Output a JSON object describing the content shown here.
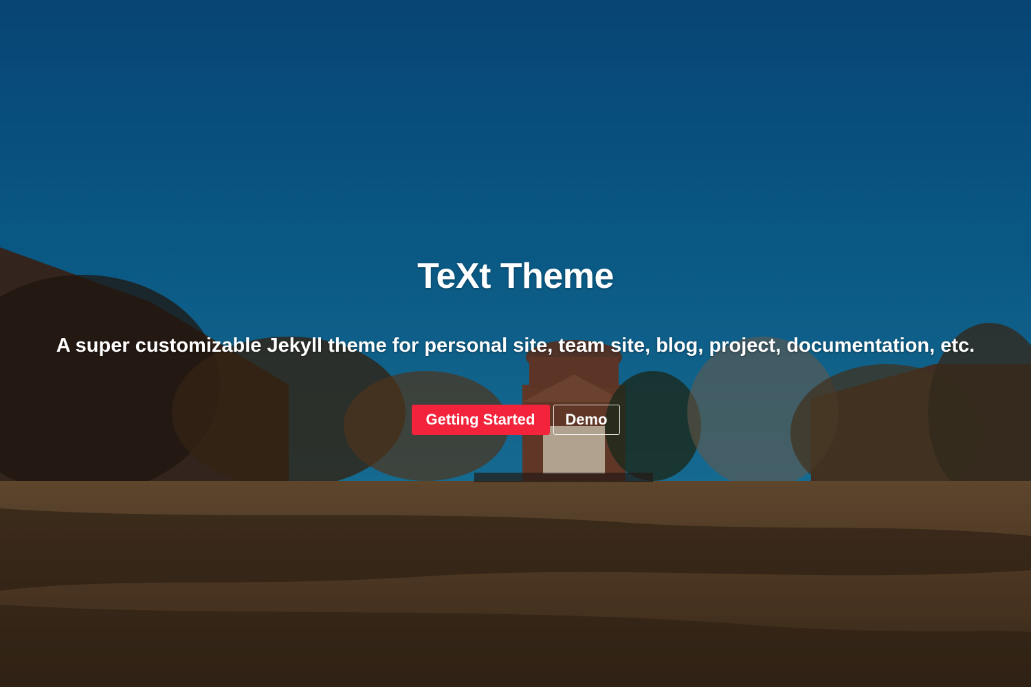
{
  "hero": {
    "title": "TeXt Theme",
    "subtitle": "A super customizable Jekyll theme for personal site, team site, blog, project, documentation, etc.",
    "background_image": "campus-lawn-photo"
  },
  "actions": {
    "getting_started_label": "Getting Started",
    "demo_label": "Demo"
  },
  "colors": {
    "primary_button": "#f2233a",
    "text": "#ffffff"
  }
}
